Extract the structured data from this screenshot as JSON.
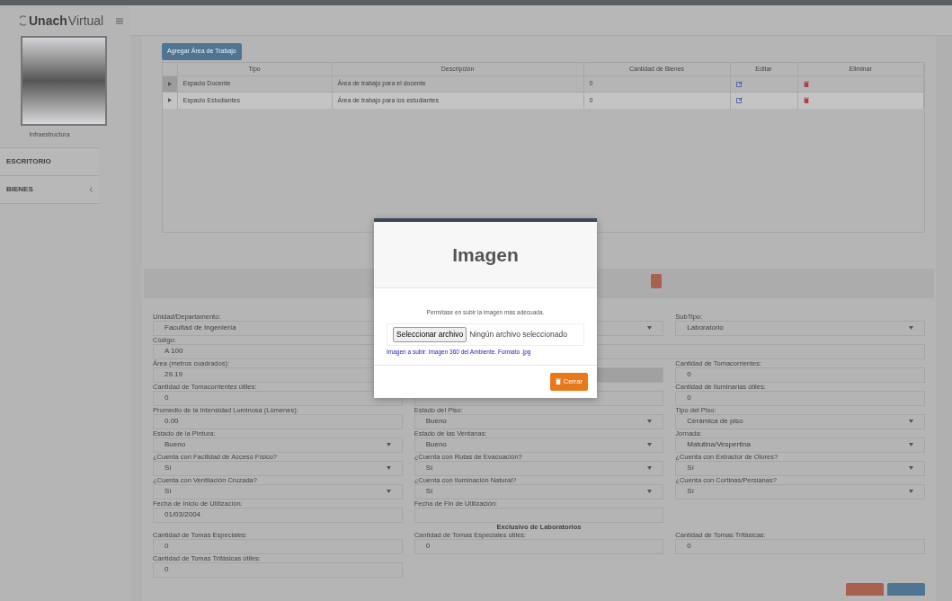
{
  "header": {
    "logo_bold": "Unach",
    "logo_light": "Virtual"
  },
  "sidebar": {
    "caption": "Infraestructura",
    "items": [
      {
        "label": "ESCRITORIO",
        "has_children": false
      },
      {
        "label": "BIENES",
        "has_children": true
      }
    ]
  },
  "toolbar": {
    "add_button": "Agregar Área de Trabajo"
  },
  "table": {
    "columns": [
      "Tipo",
      "Descripción",
      "Cantidad de Bienes",
      "Editar",
      "Eliminar"
    ],
    "rows": [
      {
        "tipo": "Espacio Docente",
        "descripcion": "Área de trabajo para el docente",
        "cantidad": "0",
        "selected": false
      },
      {
        "tipo": "Espacio Estudiantes",
        "descripcion": "Área de trabajo para los estudiantes",
        "cantidad": "0",
        "selected": true
      }
    ]
  },
  "form": {
    "rows": [
      {
        "kind": "columns",
        "fields": [
          {
            "label": "Unidad/Departamento:",
            "value": "Facultad de Ingeniería",
            "kind": "input",
            "disabled": false
          },
          {
            "kind": "select",
            "disabled": false
          },
          {
            "label": "SubTipo:",
            "value": "Laboratorio",
            "kind": "select",
            "disabled": false
          }
        ]
      },
      {
        "kind": "wide",
        "fields": [
          {
            "label": "Código:",
            "value": "A 100",
            "kind": "input",
            "disabled": false
          }
        ]
      },
      {
        "kind": "columns",
        "fields": [
          {
            "label": "Área (metros cuadrados):",
            "value": "29.19",
            "kind": "input",
            "disabled": false
          },
          {
            "kind": "input",
            "disabled": true
          },
          {
            "label": "Cantidad de Tomacorrientes:",
            "value": "0",
            "kind": "input",
            "disabled": false
          }
        ]
      },
      {
        "kind": "columns",
        "fields": [
          {
            "label": "Cantidad de Tomacorrientes útiles:",
            "value": "0",
            "kind": "input",
            "disabled": false
          },
          {
            "kind": "input",
            "disabled": false
          },
          {
            "label": "Cantidad de Iluminarias útiles:",
            "value": "0",
            "kind": "input",
            "disabled": false
          }
        ]
      },
      {
        "kind": "columns",
        "fields": [
          {
            "label": "Promedio de la Intensidad Luminosa (Lúmenes):",
            "value": "0.00",
            "kind": "input",
            "disabled": false
          },
          {
            "label": "Estado del Piso:",
            "value": "Bueno",
            "kind": "select",
            "disabled": false
          },
          {
            "label": "Tipo del Piso:",
            "value": "Cerámica de piso",
            "kind": "select",
            "disabled": false
          }
        ]
      },
      {
        "kind": "columns",
        "fields": [
          {
            "label": "Estado de la Pintura:",
            "value": "Bueno",
            "kind": "select",
            "disabled": false
          },
          {
            "label": "Estado de las Ventanas:",
            "value": "Bueno",
            "kind": "select",
            "disabled": false
          },
          {
            "label": "Jornada:",
            "value": "Matutina/Vespertina",
            "kind": "select",
            "disabled": false
          }
        ]
      },
      {
        "kind": "columns",
        "fields": [
          {
            "label": "¿Cuenta con Facilidad de Acceso Físico?",
            "value": "Sí",
            "kind": "select",
            "disabled": false
          },
          {
            "label": "¿Cuenta con Rutas de Evacuación?",
            "value": "Sí",
            "kind": "select",
            "disabled": false
          },
          {
            "label": "¿Cuenta con Extractor de Olores?",
            "value": "Sí",
            "kind": "select",
            "disabled": false
          }
        ]
      },
      {
        "kind": "columns",
        "fields": [
          {
            "label": "¿Cuenta con Ventilación Cruzada?",
            "value": "Sí",
            "kind": "select",
            "disabled": false
          },
          {
            "label": "¿Cuenta con Iluminación Natural?",
            "value": "Sí",
            "kind": "select",
            "disabled": false
          },
          {
            "label": "¿Cuenta con Cortinas/Persianas?",
            "value": "Sí",
            "kind": "select",
            "disabled": false
          }
        ]
      },
      {
        "kind": "columns",
        "fields": [
          {
            "label": "Fecha de Inicio de Utilización:",
            "value": "01/03/2004",
            "kind": "input",
            "disabled": false
          },
          {
            "label": "Fecha de Fin de Utilización:",
            "kind": "input",
            "disabled": false
          }
        ]
      },
      {
        "kind": "heading",
        "text": "Exclusivo de Laboratorios"
      },
      {
        "kind": "columns",
        "fields": [
          {
            "label": "Cantidad de Tomas Especiales:",
            "value": "0",
            "kind": "input",
            "disabled": false
          },
          {
            "label": "Cantidad de Tomas Especiales útiles:",
            "value": "0",
            "kind": "input",
            "disabled": false
          },
          {
            "label": "Cantidad de Tomas Trifásicas:",
            "value": "0",
            "kind": "input",
            "disabled": false
          }
        ]
      },
      {
        "kind": "columns",
        "fields": [
          {
            "label": "Cantidad de Tomas Trifásicas útiles:",
            "value": "0",
            "kind": "input",
            "disabled": false
          }
        ]
      }
    ]
  },
  "modal": {
    "title": "Imagen",
    "message": "Permítase en subir la imagen más adecuada.",
    "file_button": "Seleccionar archivo",
    "file_status": "Ningún archivo seleccionado",
    "help": "Imagen a subir: Imagen 360 del Ambiente. Formato .jpg",
    "close_button": "Cerrar"
  }
}
